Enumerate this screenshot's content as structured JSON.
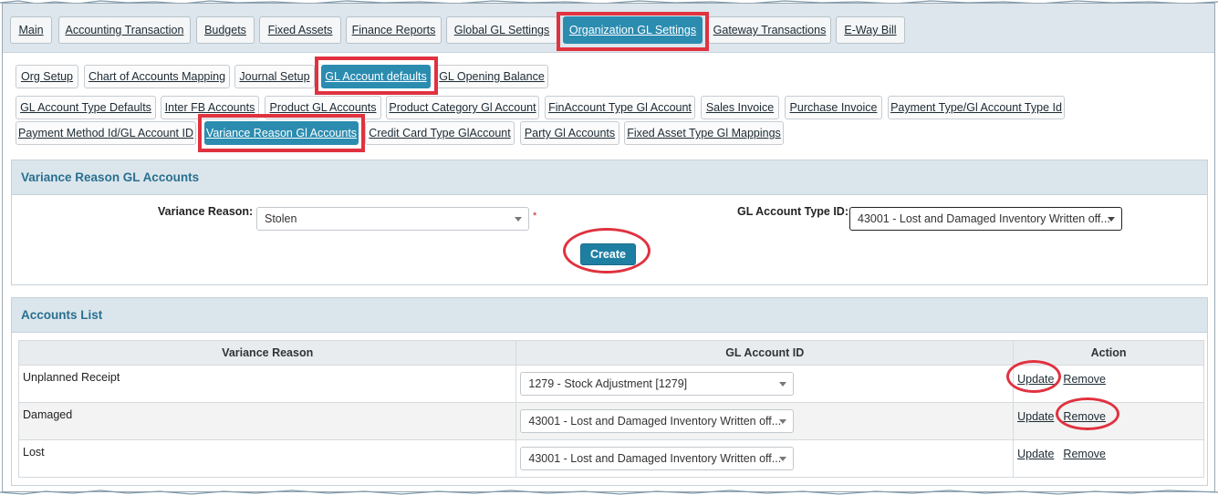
{
  "main_tabs": [
    "Main",
    "Accounting Transaction",
    "Budgets",
    "Fixed Assets",
    "Finance Reports",
    "Global GL Settings",
    "Organization GL Settings",
    "Gateway Transactions",
    "E-Way Bill"
  ],
  "sub_tabs_row1": [
    "Org Setup",
    "Chart of Accounts Mapping",
    "Journal Setup",
    "GL Account defaults",
    "GL Opening Balance"
  ],
  "sub_tabs_row2": [
    "GL Account Type Defaults",
    "Inter FB Accounts",
    "Product GL Accounts",
    "Product Category Gl Account",
    "FinAccount Type Gl Account",
    "Sales Invoice",
    "Purchase Invoice",
    "Payment Type/Gl Account Type Id"
  ],
  "sub_tabs_row3": [
    "Payment Method Id/GL Account ID",
    "Variance Reason Gl Accounts",
    "Credit Card Type GlAccount",
    "Party Gl Accounts",
    "Fixed Asset Type Gl Mappings"
  ],
  "form": {
    "title": "Variance Reason GL Accounts",
    "variance_label": "Variance Reason:",
    "variance_value": "Stolen",
    "required_mark": "*",
    "gl_type_label": "GL Account Type ID:",
    "gl_type_value": "43001 - Lost and Damaged Inventory Written off...",
    "create_label": "Create"
  },
  "list": {
    "title": "Accounts List",
    "columns": [
      "Variance Reason",
      "GL Account ID",
      "Action"
    ],
    "rows": [
      {
        "reason": "Unplanned Receipt",
        "gl": "1279 - Stock Adjustment [1279]",
        "update": "Update",
        "remove": "Remove"
      },
      {
        "reason": "Damaged",
        "gl": "43001 - Lost and Damaged Inventory Written off...",
        "update": "Update",
        "remove": "Remove"
      },
      {
        "reason": "Lost",
        "gl": "43001 - Lost and Damaged Inventory Written off...",
        "update": "Update",
        "remove": "Remove"
      }
    ]
  },
  "colors": {
    "accent": "#2b8cb0",
    "highlight": "#e0323f",
    "header_bg": "#dbe6ec"
  }
}
